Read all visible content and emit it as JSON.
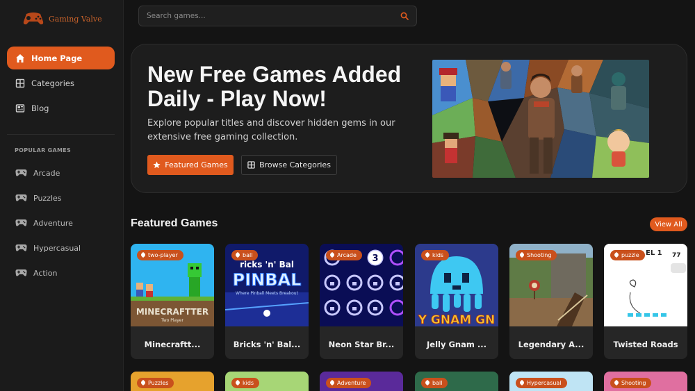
{
  "brand": {
    "name": "Gaming Valve",
    "accent": "#e05a1e"
  },
  "search": {
    "placeholder": "Search games..."
  },
  "nav": [
    {
      "label": "Home Page",
      "icon": "home-icon",
      "active": true
    },
    {
      "label": "Categories",
      "icon": "grid-icon",
      "active": false
    },
    {
      "label": "Blog",
      "icon": "newspaper-icon",
      "active": false
    }
  ],
  "popular": {
    "heading": "POPULAR GAMES",
    "items": [
      {
        "label": "Arcade",
        "icon": "gamepad-icon"
      },
      {
        "label": "Puzzles",
        "icon": "gamepad-icon"
      },
      {
        "label": "Adventure",
        "icon": "gamepad-icon"
      },
      {
        "label": "Hypercasual",
        "icon": "gamepad-icon"
      },
      {
        "label": "Action",
        "icon": "gamepad-icon"
      }
    ]
  },
  "hero": {
    "title": "New Free Games Added Daily - Play Now!",
    "description": "Explore popular titles and discover hidden gems in our extensive free gaming collection.",
    "primary_button": "Featured Games",
    "secondary_button": "Browse Categories"
  },
  "featured": {
    "title": "Featured Games",
    "view_all": "View All",
    "games": [
      {
        "name": "Minecraftt...",
        "tag": "two-player"
      },
      {
        "name": "Bricks 'n' Bal...",
        "tag": "ball"
      },
      {
        "name": "Neon Star Br...",
        "tag": "Arcade"
      },
      {
        "name": "Jelly Gnam ...",
        "tag": "kids"
      },
      {
        "name": "Legendary A...",
        "tag": "Shooting"
      },
      {
        "name": "Twisted Roads",
        "tag": "puzzle"
      }
    ],
    "second_row_tags": [
      "Puzzles",
      "kids",
      "Adventure",
      "ball",
      "Hypercasual",
      "Shooting"
    ]
  },
  "thumb_text": {
    "minecraft": "MINECRAFTTER",
    "minecraft_sub": "Two Player",
    "pinball_top": "ricks 'n' Bal",
    "pinball_big": "PINBAL",
    "pinball_sub": "Where Pinball Meets Breakout",
    "neon_num": "3",
    "jelly": "Y GNAM GN",
    "twisted_level": "EL 1",
    "twisted_score": "77"
  }
}
